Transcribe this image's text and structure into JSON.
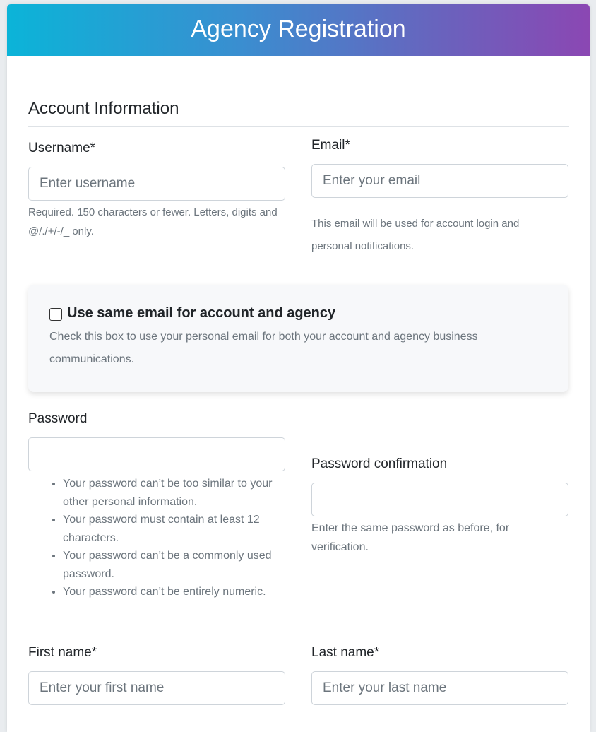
{
  "header": {
    "title": "Agency Registration"
  },
  "section": {
    "title": "Account Information"
  },
  "username": {
    "label": "Username*",
    "placeholder": "Enter username",
    "help": "Required. 150 characters or fewer. Letters, digits and @/./+/-/_ only."
  },
  "email": {
    "label": "Email*",
    "placeholder": "Enter your email",
    "help": "This email will be used for account login and personal notifications."
  },
  "same_email": {
    "label": "Use same email for account and agency",
    "help": "Check this box to use your personal email for both your account and agency business communications.",
    "checked": false
  },
  "password": {
    "label": "Password",
    "rules": [
      "Your password can’t be too similar to your other personal information.",
      "Your password must contain at least 12 characters.",
      "Your password can’t be a commonly used password.",
      "Your password can’t be entirely numeric."
    ]
  },
  "password_confirmation": {
    "label": "Password confirmation",
    "help": "Enter the same password as before, for verification."
  },
  "first_name": {
    "label": "First name*",
    "placeholder": "Enter your first name"
  },
  "last_name": {
    "label": "Last name*",
    "placeholder": "Enter your last name"
  }
}
